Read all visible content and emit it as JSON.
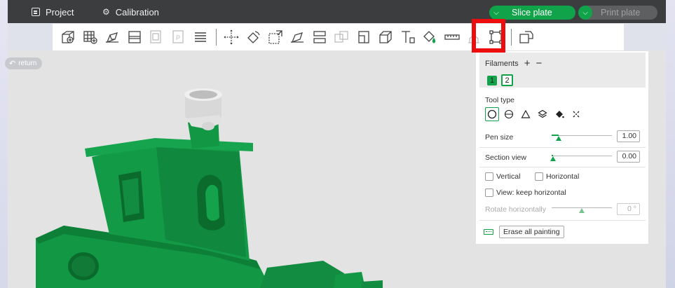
{
  "topbar": {
    "project_label": "Project",
    "calibration_label": "Calibration",
    "slice_label": "Slice plate",
    "print_label": "Print plate",
    "icons": [
      "project-icon",
      "calibration-gear-icon",
      "chevron-down-icon"
    ]
  },
  "toolbar": {
    "icons": [
      "add-object-icon",
      "arrange-grid-icon",
      "orient-icon",
      "split-layout-icon",
      "plate-object-icon",
      "plate-p-icon",
      "layers-icon",
      "move-icon",
      "rotate-icon",
      "scale-icon",
      "lay-on-face-icon",
      "cut-icon",
      "boolean-icon",
      "support-paint-icon",
      "seam-paint-icon",
      "text-emboss-icon",
      "color-paint-icon",
      "measure-icon",
      "assembly-icon",
      "part-select-icon",
      "variable-layer-icon"
    ],
    "highlighted_tool": "color-paint-icon"
  },
  "viewport": {
    "return_label": "return",
    "model_color": "#11903c"
  },
  "panel": {
    "filaments_label": "Filaments",
    "add_symbol": "+",
    "remove_symbol": "−",
    "filament_1": "1",
    "filament_2": "2",
    "filament_1_color": "#11a34a",
    "tool_type_label": "Tool type",
    "tool_types": [
      "circle-brush-icon",
      "sphere-brush-icon",
      "triangle-icon",
      "height-range-icon",
      "fill-bucket-icon",
      "gap-fill-icon"
    ],
    "pen_size_label": "Pen size",
    "pen_size_value": "1.00",
    "pen_size_fraction": 0.12,
    "section_view_label": "Section view",
    "section_view_value": "0.00",
    "section_view_fraction": 0.0,
    "vertical_label": "Vertical",
    "horizontal_label": "Horizontal",
    "keep_horizontal_label": "View: keep horizontal",
    "rotate_label": "Rotate horizontally",
    "rotate_value": "0 °",
    "rotate_fraction": 0.5,
    "erase_label": "Erase all painting"
  },
  "colors": {
    "accent": "#11a34a",
    "topbar": "#3b3d3f",
    "highlight": "#ee0d0d"
  }
}
